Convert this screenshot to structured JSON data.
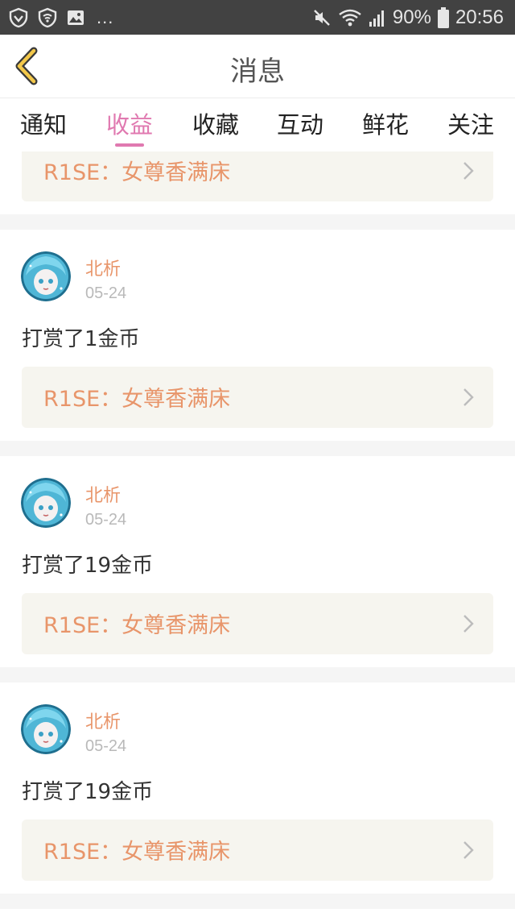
{
  "status_bar": {
    "battery": "90%",
    "time": "20:56",
    "more": "...",
    "left_icons": [
      "shield-icon",
      "wifi-shield-icon",
      "image-icon"
    ],
    "right_icons": [
      "mute-icon",
      "wifi-icon",
      "signal-icon",
      "battery-icon"
    ]
  },
  "header": {
    "title": "消息",
    "back_icon": "chevron-left-icon"
  },
  "tabs": [
    {
      "label": "通知",
      "active": false
    },
    {
      "label": "收益",
      "active": true
    },
    {
      "label": "收藏",
      "active": false
    },
    {
      "label": "互动",
      "active": false
    },
    {
      "label": "鲜花",
      "active": false
    },
    {
      "label": "关注",
      "active": false
    }
  ],
  "colors": {
    "accent": "#e079b0",
    "link": "#e8956a",
    "status_bar": "#424242"
  },
  "feed": {
    "partial_link": "R1SE：女尊香满床",
    "items": [
      {
        "user": "北析",
        "date": "05-24",
        "message": "打赏了1金币",
        "link": "R1SE：女尊香满床"
      },
      {
        "user": "北析",
        "date": "05-24",
        "message": "打赏了19金币",
        "link": "R1SE：女尊香满床"
      },
      {
        "user": "北析",
        "date": "05-24",
        "message": "打赏了19金币",
        "link": "R1SE：女尊香满床"
      }
    ]
  }
}
